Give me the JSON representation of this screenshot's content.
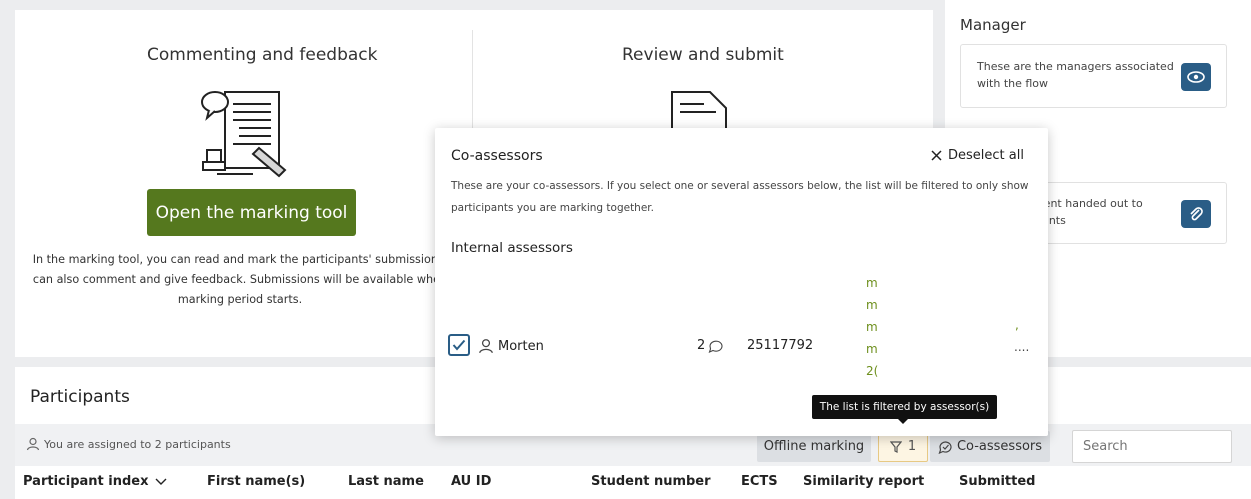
{
  "cards": {
    "commenting": {
      "title": "Commenting and feedback",
      "button": "Open the marking tool",
      "description_lines": [
        "In the marking tool, you can read and mark the participants' submissions.",
        "can also comment and give feedback. Submissions will be available when",
        "marking period starts."
      ]
    },
    "review": {
      "title": "Review and submit"
    }
  },
  "sidebar": {
    "manager_title": "Manager",
    "manager_text_lines": [
      "These are the managers associated",
      "with the flow"
    ],
    "assignment_text_lines": [
      "nment handed out to",
      "cipants"
    ]
  },
  "popover": {
    "title": "Co-assessors",
    "deselect": "Deselect all",
    "description_lines": [
      "These are your co-assessors. If you select one or several assessors below, the list will be filtered to only show",
      "participants you are marking together."
    ],
    "subheading": "Internal assessors",
    "assessor": {
      "name": "Morten",
      "count": "2",
      "number": "25117792",
      "fragments": [
        "m",
        "m",
        "m",
        "m",
        "2("
      ],
      "tail_comma": ",",
      "tail_dots": "...."
    }
  },
  "tooltip": "The list is filtered by assessor(s)",
  "participants": {
    "title": "Participants",
    "assigned": "You are assigned to 2 participants",
    "offline_button": "Offline marking",
    "filter_count": "1",
    "coassessors_button": "Co-assessors",
    "search_placeholder": "Search",
    "columns": [
      "Participant index",
      "First name(s)",
      "Last name",
      "AU ID",
      "Student number",
      "ECTS",
      "Similarity report",
      "Submitted"
    ]
  },
  "colors": {
    "brand_green": "#55781e",
    "brand_blue": "#2a5d86"
  },
  "icons": [
    "speech-document-icon",
    "document-icon",
    "eye-icon",
    "paperclip-icon",
    "close-icon",
    "person-icon",
    "comment-icon",
    "filter-icon",
    "check-comment-icon",
    "chevron-down-icon",
    "checkmark-icon"
  ]
}
